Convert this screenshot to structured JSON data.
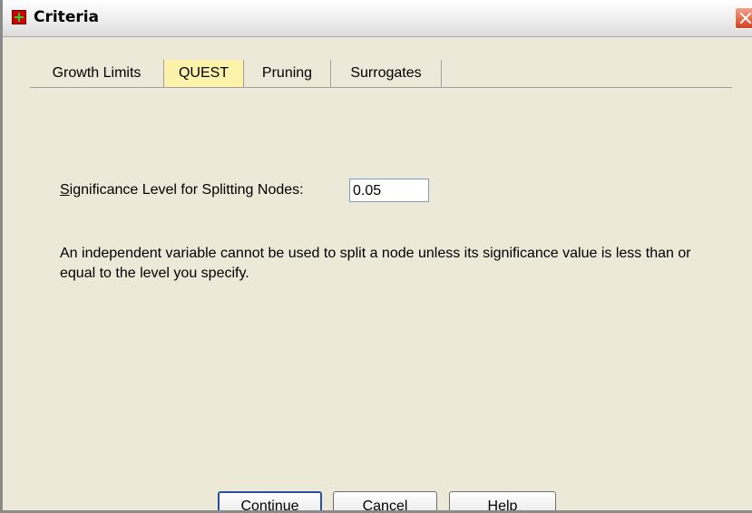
{
  "window": {
    "title": "Criteria"
  },
  "tabs": [
    {
      "label": "Growth Limits"
    },
    {
      "label": "QUEST"
    },
    {
      "label": "Pruning"
    },
    {
      "label": "Surrogates"
    }
  ],
  "significance": {
    "label_prefix": "S",
    "label_rest": "ignificance Level for Splitting Nodes:",
    "value": "0.05"
  },
  "description": "An independent variable cannot be used to split a node unless its significance value is less than or equal to the level you specify.",
  "buttons": {
    "continue": "Continue",
    "cancel": "Cancel",
    "help": "Help"
  }
}
